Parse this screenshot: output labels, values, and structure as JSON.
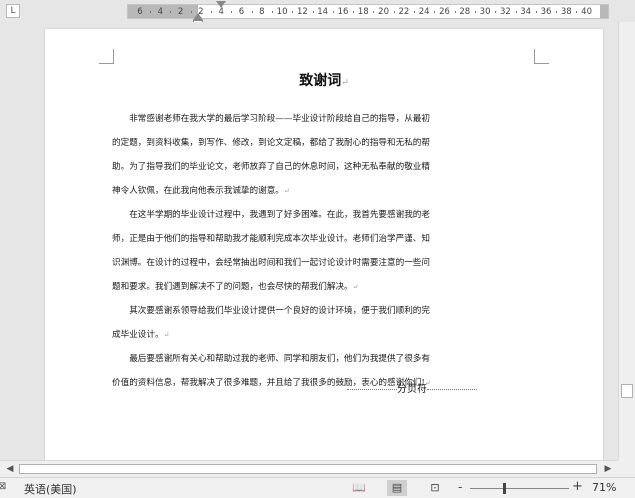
{
  "ruler": {
    "corner_glyph": "L",
    "ticks": [
      "6",
      "4",
      "2",
      "2",
      "4",
      "6",
      "8",
      "10",
      "12",
      "14",
      "16",
      "18",
      "20",
      "22",
      "24",
      "26",
      "28",
      "30",
      "32",
      "34",
      "36",
      "38",
      "40"
    ]
  },
  "document": {
    "title": "致谢词",
    "paragraph_mark": "↵",
    "paragraphs": [
      [
        "非常感谢老师在我大学的最后学习阶段——毕业设计阶段给自己的指导，从最初",
        "的定题，到资料收集，到写作、修改，到论文定稿，都给了我耐心的指导和无私的帮",
        "助。为了指导我们的毕业论文，老师放弃了自己的休息时间，这种无私奉献的敬业精",
        "神令人钦佩，在此我向他表示我诚挚的谢意。"
      ],
      [
        "在这半学期的毕业设计过程中，我遇到了好多困难。在此，我首先要感谢我的老",
        "师，正是由于他们的指导和帮助我才能顺利完成本次毕业设计。老师们治学严谨、知",
        "识渊博。在设计的过程中，会经常抽出时间和我们一起讨论设计时需要注意的一些问",
        "题和要求。我们遇到解决不了的问题，也会尽快的帮我们解决。"
      ],
      [
        "其次要感谢系领导给我们毕业设计提供一个良好的设计环境，便于我们顺利的完",
        "成毕业设计。"
      ],
      [
        "最后要感谢所有关心和帮助过我的老师、同学和朋友们，他们为我提供了很多有",
        "价值的资料信息，帮我解决了很多难题，并且给了我很多的鼓励，衷心的感谢你们!"
      ]
    ],
    "page_break_label": "分页符"
  },
  "scrollbars": {
    "left_arrow": "◀",
    "right_arrow": "▶"
  },
  "status_bar": {
    "language_icon": "⊠",
    "language": "英语(美国)",
    "read_mode_icon": "📖",
    "print_layout_icon": "▤",
    "web_layout_icon": "⊡",
    "zoom_minus": "-",
    "zoom_plus": "+",
    "zoom_level": "71%"
  }
}
